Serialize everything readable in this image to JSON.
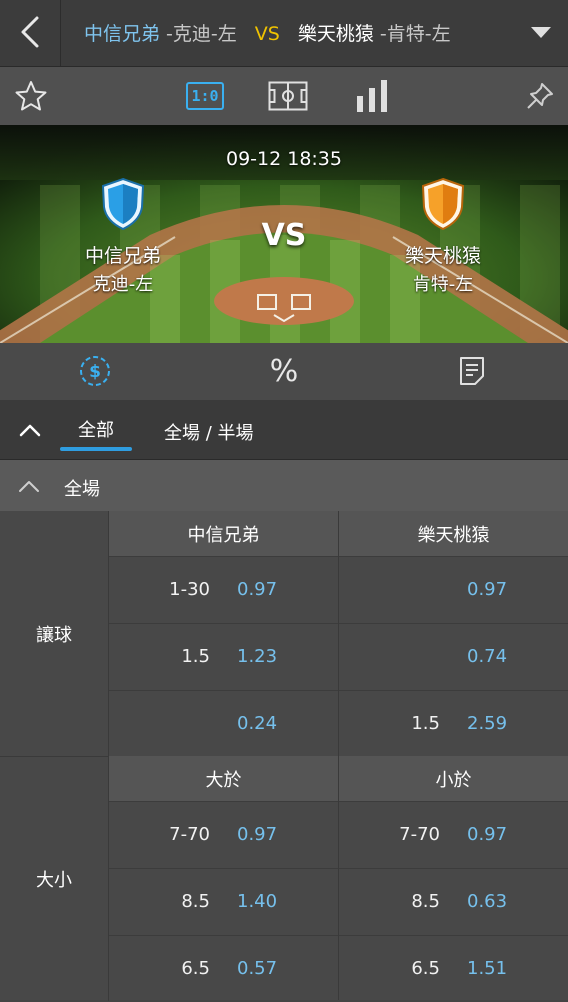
{
  "header": {
    "home_team": "中信兄弟",
    "home_pitcher": " -克迪-左",
    "vs": "VS",
    "away_team": "樂天桃猿",
    "away_pitcher": " -肯特-左"
  },
  "toolbar": {
    "score_label": "1:0"
  },
  "match": {
    "datetime": "09-12 18:35",
    "vs": "VS",
    "home": {
      "name": "中信兄弟",
      "pitcher": "克迪-左",
      "color": "#2a9fe6"
    },
    "away": {
      "name": "樂天桃猿",
      "pitcher": "肯特-左",
      "color": "#f39a1e"
    }
  },
  "tabs3": {
    "percent_label": "%"
  },
  "filters": {
    "all": "全部",
    "full_half": "全場 / 半場"
  },
  "section": {
    "title": "全場"
  },
  "handicap": {
    "label": "讓球",
    "home_header": "中信兄弟",
    "away_header": "樂天桃猿",
    "rows": [
      {
        "home_line": "1-30",
        "home_odds": "0.97",
        "away_line": "",
        "away_odds": "0.97"
      },
      {
        "home_line": "1.5",
        "home_odds": "1.23",
        "away_line": "",
        "away_odds": "0.74"
      },
      {
        "home_line": "",
        "home_odds": "0.24",
        "away_line": "1.5",
        "away_odds": "2.59"
      }
    ]
  },
  "totals": {
    "label": "大小",
    "over_header": "大於",
    "under_header": "小於",
    "rows": [
      {
        "over_line": "7-70",
        "over_odds": "0.97",
        "under_line": "7-70",
        "under_odds": "0.97"
      },
      {
        "over_line": "8.5",
        "over_odds": "1.40",
        "under_line": "8.5",
        "under_odds": "0.63"
      },
      {
        "over_line": "6.5",
        "over_odds": "0.57",
        "under_line": "6.5",
        "under_odds": "1.51"
      }
    ]
  },
  "colors": {
    "accent": "#2f9de0",
    "odds": "#76c0ec",
    "vs_yellow": "#f0c300"
  }
}
